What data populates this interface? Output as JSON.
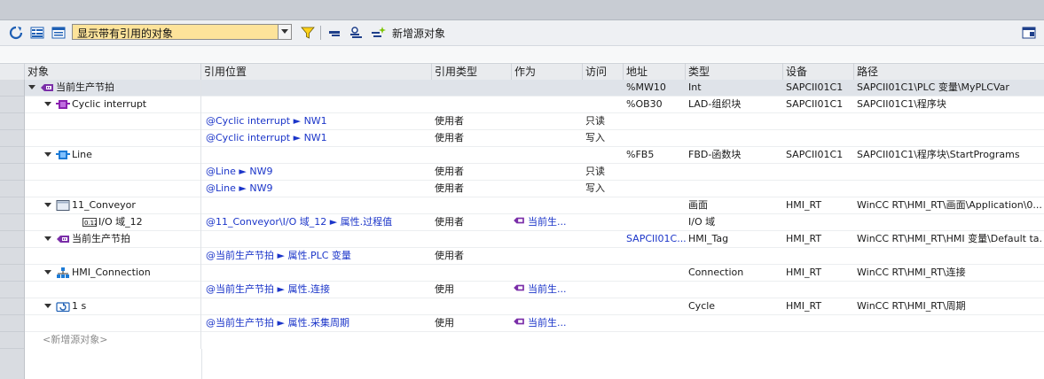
{
  "toolbar": {
    "filter_value": "显示带有引用的对象",
    "add_source_label": "新增源对象"
  },
  "columns": [
    "对象",
    "引用位置",
    "引用类型",
    "作为",
    "访问",
    "地址",
    "类型",
    "设备",
    "路径"
  ],
  "rows": [
    {
      "object": "当前生产节拍",
      "icon": "plc-tag-icon",
      "expanded": true,
      "location": "",
      "ref_type": "",
      "as": "",
      "access": "",
      "address": "%MW10",
      "type": "Int",
      "device": "SAPCII01C1",
      "path": "SAPCII01C1\\PLC 变量\\MyPLCVar",
      "selected": true
    },
    {
      "object": "Cyclic interrupt",
      "icon": "ob-block-icon",
      "expanded": true,
      "location": "",
      "ref_type": "",
      "as": "",
      "access": "",
      "address": "%OB30",
      "type": "LAD-组织块",
      "device": "SAPCII01C1",
      "path": "SAPCII01C1\\程序块"
    },
    {
      "object": "",
      "location": "@Cyclic interrupt ► NW1",
      "ref_type": "使用者",
      "as": "",
      "access": "只读",
      "address": "",
      "type": "",
      "device": "",
      "path": ""
    },
    {
      "object": "",
      "location": "@Cyclic interrupt ► NW1",
      "ref_type": "使用者",
      "as": "",
      "access": "写入",
      "address": "",
      "type": "",
      "device": "",
      "path": ""
    },
    {
      "object": "Line",
      "icon": "fb-block-icon",
      "expanded": true,
      "location": "",
      "ref_type": "",
      "as": "",
      "access": "",
      "address": "%FB5",
      "type": "FBD-函数块",
      "device": "SAPCII01C1",
      "path": "SAPCII01C1\\程序块\\StartPrograms"
    },
    {
      "object": "",
      "location": "@Line ► NW9",
      "ref_type": "使用者",
      "as": "",
      "access": "只读",
      "address": "",
      "type": "",
      "device": "",
      "path": ""
    },
    {
      "object": "",
      "location": "@Line ► NW9",
      "ref_type": "使用者",
      "as": "",
      "access": "写入",
      "address": "",
      "type": "",
      "device": "",
      "path": ""
    },
    {
      "object": "11_Conveyor",
      "icon": "screen-icon",
      "expanded": true,
      "location": "",
      "ref_type": "",
      "as": "",
      "access": "",
      "address": "",
      "type": "画面",
      "device": "HMI_RT",
      "path": "WinCC RT\\HMI_RT\\画面\\Application\\0..."
    },
    {
      "object": "I/O 域_12",
      "icon": "io-field-icon",
      "child": true,
      "location": "@11_Conveyor\\I/O 域_12 ► 属性.过程值",
      "ref_type": "使用者",
      "as": "当前生...",
      "access": "",
      "address": "",
      "type": "I/O 域",
      "device": "",
      "path": ""
    },
    {
      "object": "当前生产节拍",
      "icon": "hmi-tag-icon",
      "expanded": true,
      "location": "",
      "ref_type": "",
      "as": "",
      "access": "",
      "address": "SAPCII01C...",
      "type": "HMI_Tag",
      "device": "HMI_RT",
      "path": "WinCC RT\\HMI_RT\\HMI 变量\\Default ta..."
    },
    {
      "object": "",
      "location": "@当前生产节拍 ► 属性.PLC 变量",
      "ref_type": "使用者",
      "as": "",
      "access": "",
      "address": "",
      "type": "",
      "device": "",
      "path": ""
    },
    {
      "object": "HMI_Connection",
      "icon": "connection-icon",
      "expanded": true,
      "location": "",
      "ref_type": "",
      "as": "",
      "access": "",
      "address": "",
      "type": "Connection",
      "device": "HMI_RT",
      "path": "WinCC RT\\HMI_RT\\连接"
    },
    {
      "object": "",
      "location": "@当前生产节拍 ► 属性.连接",
      "ref_type": "使用",
      "as": "当前生...",
      "access": "",
      "address": "",
      "type": "",
      "device": "",
      "path": ""
    },
    {
      "object": "1 s",
      "icon": "cycle-icon",
      "expanded": true,
      "location": "",
      "ref_type": "",
      "as": "",
      "access": "",
      "address": "",
      "type": "Cycle",
      "device": "HMI_RT",
      "path": "WinCC RT\\HMI_RT\\周期"
    },
    {
      "object": "",
      "location": "@当前生产节拍 ► 属性.采集周期",
      "ref_type": "使用",
      "as": "当前生...",
      "access": "",
      "address": "",
      "type": "",
      "device": "",
      "path": ""
    }
  ],
  "add_new": "<新增源对象>"
}
